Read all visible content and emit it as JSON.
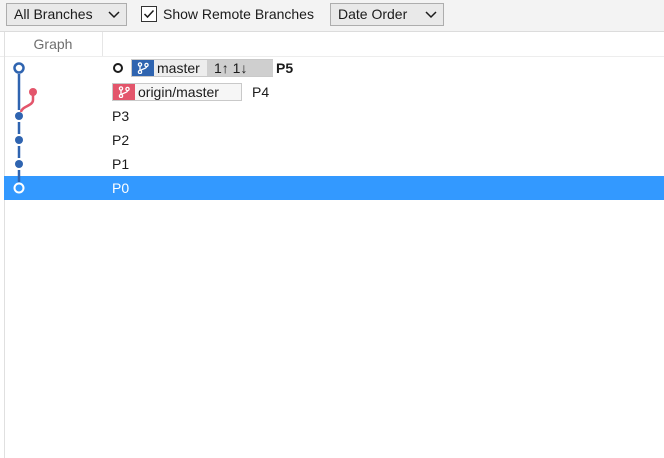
{
  "toolbar": {
    "branches_dropdown": "All Branches",
    "show_remote_label": "Show Remote Branches",
    "show_remote_checked": true,
    "order_dropdown": "Date Order"
  },
  "header": {
    "graph_label": "Graph"
  },
  "colors": {
    "master_lane": "#2f64b0",
    "origin_lane": "#e3556b",
    "selection": "#3399ff"
  },
  "commits": [
    {
      "subject": "P5",
      "branches": [
        {
          "name": "master",
          "ahead_behind": "1↑ 1↓",
          "type": "local",
          "icon": "branch-icon"
        }
      ],
      "is_head": true,
      "selected": false
    },
    {
      "subject": "P4",
      "branches": [
        {
          "name": "origin/master",
          "type": "remote",
          "icon": "branch-icon"
        }
      ],
      "is_head": false,
      "selected": false
    },
    {
      "subject": "P3",
      "branches": [],
      "is_head": false,
      "selected": false
    },
    {
      "subject": "P2",
      "branches": [],
      "is_head": false,
      "selected": false
    },
    {
      "subject": "P1",
      "branches": [],
      "is_head": false,
      "selected": false
    },
    {
      "subject": "P0",
      "branches": [],
      "is_head": false,
      "selected": true
    }
  ]
}
